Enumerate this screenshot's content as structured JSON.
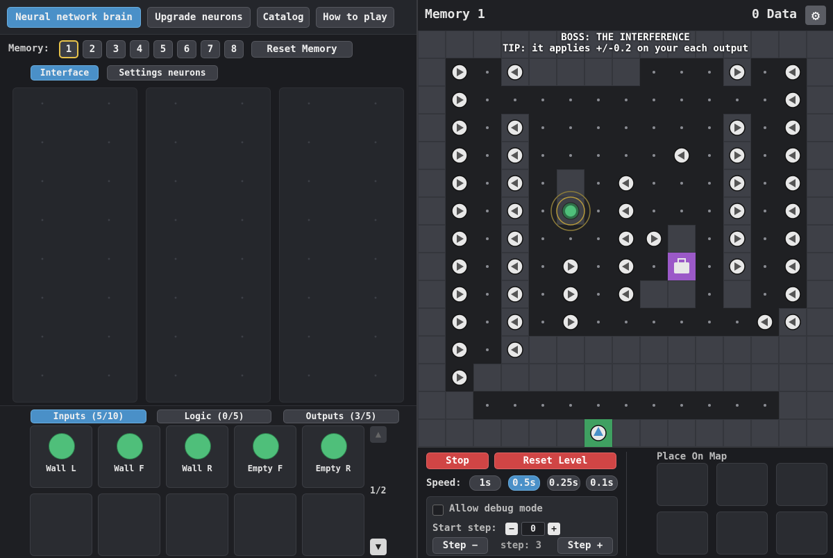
{
  "top_tabs": [
    "Neural network brain",
    "Upgrade neurons",
    "Catalog",
    "How to play"
  ],
  "memory": {
    "label": "Memory:",
    "slots": [
      "1",
      "2",
      "3",
      "4",
      "5",
      "6",
      "7",
      "8"
    ],
    "selected": "1",
    "reset_label": "Reset Memory"
  },
  "subtabs": {
    "interface": "Interface",
    "settings": "Settings neurons"
  },
  "bottom_tabs": {
    "inputs": "Inputs (5/10)",
    "logic": "Logic (0/5)",
    "outputs": "Outputs (3/5)"
  },
  "input_cards": [
    "Wall L",
    "Wall F",
    "Wall R",
    "Empty F",
    "Empty R"
  ],
  "pager": "1/2",
  "game": {
    "title": "Memory 1",
    "data_counter": "0 Data",
    "boss_line": "BOSS: THE INTERFERENCE",
    "tip_line": "TIP: it applies +/-0.2 on your each output"
  },
  "controls": {
    "stop": "Stop",
    "reset_level": "Reset Level",
    "speed_label": "Speed:",
    "speeds": [
      "1s",
      "0.5s",
      "0.25s",
      "0.1s"
    ],
    "active_speed": "0.5s",
    "allow_debug": "Allow debug mode",
    "start_step_label": "Start step:",
    "minus": "−",
    "plus": "+",
    "start_step_value": "0",
    "step_minus": "Step −",
    "step_info": "step: 3",
    "step_plus": "Step +",
    "place_on_map": "Place On Map"
  },
  "colors": {
    "accent": "#4a90c8",
    "danger": "#d04545",
    "input_node": "#4fbf7a",
    "selected_memory_border": "#e8c34a",
    "goal_tile": "#9b59c8",
    "start_tile": "#3fa061"
  }
}
